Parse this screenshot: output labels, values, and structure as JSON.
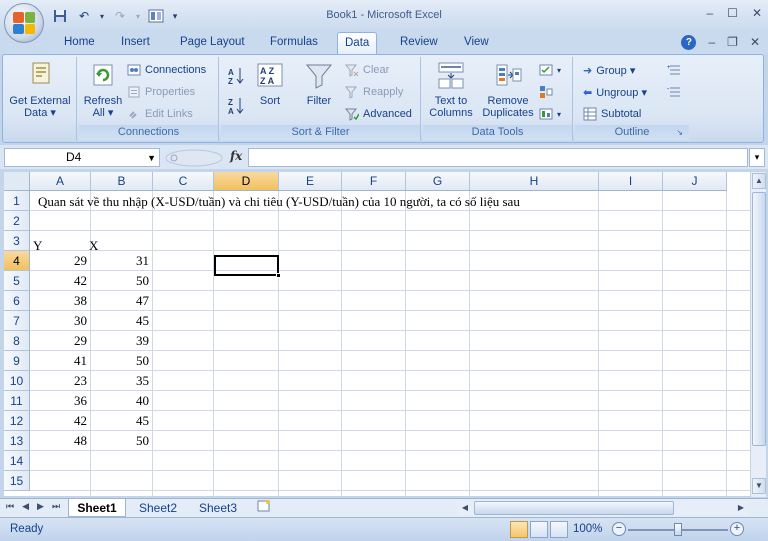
{
  "window": {
    "title": "Book1 - Microsoft Excel",
    "controls": [
      "–",
      "☐",
      "✕"
    ]
  },
  "qat": {
    "save_icon": "save-icon",
    "undo_icon": "undo-icon",
    "redo_icon": "redo-icon",
    "customize_icon": "customize-icon"
  },
  "tabs": [
    {
      "label": "Home"
    },
    {
      "label": "Insert"
    },
    {
      "label": "Page Layout"
    },
    {
      "label": "Formulas"
    },
    {
      "label": "Data"
    },
    {
      "label": "Review"
    },
    {
      "label": "View"
    }
  ],
  "active_tab": "Data",
  "ribbon": {
    "get_external_data": {
      "line1": "Get External",
      "line2": "Data ▾"
    },
    "refresh_all": {
      "line1": "Refresh",
      "line2": "All ▾"
    },
    "connections": "Connections",
    "properties": "Properties",
    "edit_links": "Edit Links",
    "connections_group": "Connections",
    "sort_az": "A→Z",
    "sort_za": "Z→A",
    "sort": "Sort",
    "filter": "Filter",
    "clear": "Clear",
    "reapply": "Reapply",
    "advanced": "Advanced",
    "sort_filter_group": "Sort & Filter",
    "text_to_columns": {
      "line1": "Text to",
      "line2": "Columns"
    },
    "remove_duplicates": {
      "line1": "Remove",
      "line2": "Duplicates"
    },
    "data_tools_group": "Data Tools",
    "group": "Group ▾",
    "ungroup": "Ungroup ▾",
    "subtotal": "Subtotal",
    "outline_group": "Outline"
  },
  "formula_bar": {
    "name_box": "D4",
    "fx": "fx",
    "formula": ""
  },
  "sheet": {
    "columns": [
      "A",
      "B",
      "C",
      "D",
      "E",
      "F",
      "G",
      "H",
      "I",
      "J"
    ],
    "rows": [
      "1",
      "2",
      "3",
      "4",
      "5",
      "6",
      "7",
      "8",
      "9",
      "10",
      "11",
      "12",
      "13",
      "14",
      "15"
    ],
    "title_text": "Quan sát về thu nhập (X-USD/tuần) và chi tiêu  (Y-USD/tuần) của 10 người, ta có số liệu sau",
    "header_y": "Y",
    "header_x": "X",
    "data": [
      {
        "y": "29",
        "x": "31"
      },
      {
        "y": "42",
        "x": "50"
      },
      {
        "y": "38",
        "x": "47"
      },
      {
        "y": "30",
        "x": "45"
      },
      {
        "y": "29",
        "x": "39"
      },
      {
        "y": "41",
        "x": "50"
      },
      {
        "y": "23",
        "x": "35"
      },
      {
        "y": "36",
        "x": "40"
      },
      {
        "y": "42",
        "x": "45"
      },
      {
        "y": "48",
        "x": "50"
      }
    ],
    "active_cell": "D4"
  },
  "sheet_tabs": [
    {
      "label": "Sheet1"
    },
    {
      "label": "Sheet2"
    },
    {
      "label": "Sheet3"
    }
  ],
  "status": {
    "ready": "Ready",
    "zoom": "100%",
    "zoom_level_percent": 100
  },
  "colors": {
    "ribbon_text": "#15428b",
    "selected_header": "#f1c15f"
  }
}
